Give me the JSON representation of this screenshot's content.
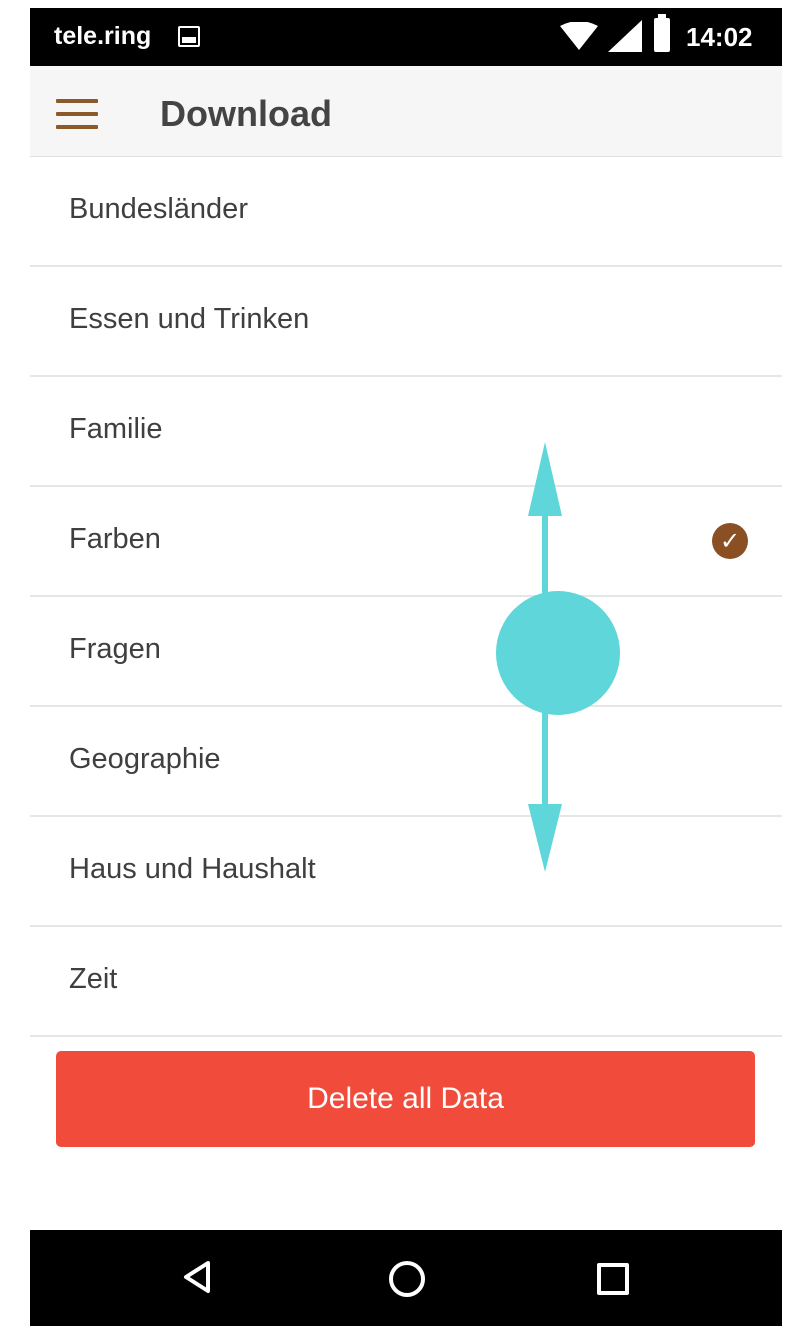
{
  "status_bar": {
    "carrier": "tele.ring",
    "time": "14:02",
    "icons": [
      "gallery-icon",
      "wifi-icon",
      "signal-icon",
      "battery-icon"
    ]
  },
  "app_bar": {
    "title": "Download",
    "menu_icon": "hamburger-menu-icon"
  },
  "categories": [
    {
      "label": "Bundesländer",
      "downloaded": false
    },
    {
      "label": "Essen und Trinken",
      "downloaded": false
    },
    {
      "label": "Familie",
      "downloaded": false
    },
    {
      "label": "Farben",
      "downloaded": true
    },
    {
      "label": "Fragen",
      "downloaded": false
    },
    {
      "label": "Geographie",
      "downloaded": false
    },
    {
      "label": "Haus und Haushalt",
      "downloaded": false
    },
    {
      "label": "Zeit",
      "downloaded": false
    }
  ],
  "actions": {
    "delete_label": "Delete all Data"
  },
  "nav_bar": {
    "icons": [
      "back-icon",
      "home-icon",
      "recents-icon"
    ]
  },
  "gesture": {
    "type": "vertical-swipe",
    "color": "#5fd6d9"
  },
  "colors": {
    "accent": "#8b5a2b",
    "delete_button": "#f14b3c",
    "check": "#8b4f24"
  }
}
